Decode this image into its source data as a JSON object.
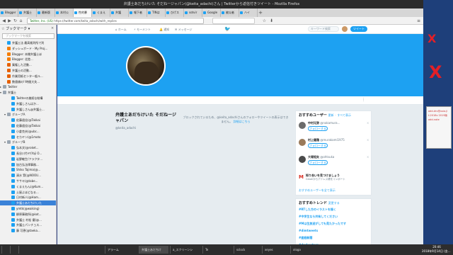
{
  "window": {
    "title": "弁護士あだちけいた そだねージャパン(@keita_adachi)さん | Twitterから返信付きツイート - Mozilla Firefox"
  },
  "tabs": [
    "Blogger",
    "弁護士",
    "最新版",
    "本村公",
    "性的暴",
    "くまえ",
    "弁護",
    "報下者",
    "TINは",
    "ひげス",
    "sotvir",
    "Google",
    "被災者",
    "ハイ"
  ],
  "navbar": {
    "url_secure": "Twitter, Inc. (US)",
    "url": "https://twitter.com/keita_adachi/with_replies"
  },
  "sidebar": {
    "title": "ブックマーク",
    "close": "×",
    "search_placeholder": "ブックマークを検索",
    "items": [
      {
        "label": "弁護士法 最高裁判所で判",
        "icon": "tw",
        "indent": 1
      },
      {
        "label": "ダッシュボード - My Proj...",
        "icon": "bg",
        "indent": 1
      },
      {
        "label": "Blogger: 本棚弁護士ほ",
        "icon": "bg",
        "indent": 1
      },
      {
        "label": "Blogger: 北陸...",
        "icon": "bg",
        "indent": 1
      },
      {
        "label": "棄権した活動...",
        "icon": "fx",
        "indent": 1
      },
      {
        "label": "弁護士の活動...",
        "icon": "fx",
        "indent": 1
      },
      {
        "label": "作業用紙センタ一般ル...",
        "icon": "fx",
        "indent": 1
      },
      {
        "label": "数値順の!!時間大失...",
        "icon": "fx",
        "indent": 1
      },
      {
        "label": "Twitter",
        "icon": "fd",
        "indent": 0,
        "folder": true
      },
      {
        "label": "弁護士",
        "icon": "fd",
        "indent": 0,
        "folder": true,
        "open": true
      },
      {
        "label": "Twitterの美紙な結構",
        "icon": "tw",
        "indent": 2
      },
      {
        "label": "弁護しさんはか...",
        "icon": "tw",
        "indent": 2
      },
      {
        "label": "弁護しさん@弁護士...",
        "icon": "tw",
        "indent": 2
      },
      {
        "label": "グループA",
        "icon": "fd",
        "indent": 1,
        "folder": true,
        "open": true
      },
      {
        "label": "佐藤遥佳(@Takkai",
        "icon": "tw",
        "indent": 2
      },
      {
        "label": "佐藤遥佳(@Takkai",
        "icon": "tw",
        "indent": 2
      },
      {
        "label": "小倉克夫(@ubc...",
        "icon": "tw",
        "indent": 2
      },
      {
        "label": "セカヤン(@1moto",
        "icon": "tw",
        "indent": 2
      },
      {
        "label": "グループB",
        "icon": "fd",
        "indent": 1,
        "folder": true,
        "open": true
      },
      {
        "label": "弘本文(@roket...",
        "icon": "tw",
        "indent": 2
      },
      {
        "label": "長谷川竹ヤ(Yoji O...",
        "icon": "tw",
        "indent": 2
      },
      {
        "label": "岩野敏生/フラクタ...",
        "icon": "tw",
        "indent": 2
      },
      {
        "label": "加古弘法律事務...",
        "icon": "tw",
        "indent": 2
      },
      {
        "label": "Shiko Tajima(@...",
        "icon": "tw",
        "indent": 2
      },
      {
        "label": "清水 賢(@NOOU...",
        "icon": "tw",
        "indent": 2
      },
      {
        "label": "ササキ(@tabe...",
        "icon": "tw",
        "indent": 2
      },
      {
        "label": "くまえもん(@Kum...",
        "icon": "tw",
        "indent": 2
      },
      {
        "label": "土屋よほどなる...",
        "icon": "tw",
        "indent": 2
      },
      {
        "label": "日村新人(@Ham...",
        "icon": "tw",
        "indent": 2
      },
      {
        "label": "弁護士あだちけいた",
        "icon": "tw",
        "indent": 2,
        "selected": true
      },
      {
        "label": "ymtk(@waiking)",
        "icon": "tw",
        "indent": 2
      },
      {
        "label": "柳原事務所(@kot...",
        "icon": "tw",
        "indent": 2
      },
      {
        "label": "弁護士 村松 優(@...",
        "icon": "tw",
        "indent": 2
      },
      {
        "label": "弁護士パンチョス...",
        "icon": "tw",
        "indent": 2
      },
      {
        "label": "藤 可恵(@taeka...",
        "icon": "tw",
        "indent": 2
      }
    ]
  },
  "twitter_nav": {
    "home": "ホーム",
    "moments": "モーメント",
    "notifications": "通知",
    "messages": "メッセージ",
    "search_placeholder": "キーワード検索",
    "tweet_button": "ツイート"
  },
  "profile": {
    "name": "弁護士あだちけいた そだねージャパン",
    "handle": "@keita_adachi",
    "protected_msg": "ブロックされているため、@keita_adachiさんのフォローやツイートの表示はできません。",
    "protected_link": "詳細はこちら",
    "more": "⋮"
  },
  "who_to_follow": {
    "title": "おすすめユーザー",
    "reload": "更新",
    "view_all": "すべて表示",
    "users": [
      {
        "name": "中村元弥",
        "handle": "@nakamura...",
        "follow": "フォローする",
        "avatar_color": "#6b6b6b"
      },
      {
        "name": "村上健雅",
        "handle": "@murakami1975",
        "follow": "フォローする",
        "avatar_color": "#9a7a5a"
      },
      {
        "name": "大塚拓矢",
        "handle": "@ohtsuka",
        "follow": "フォローする",
        "avatar_color": "#4a4a4a"
      }
    ],
    "gmail_title": "知り合いを見つけましょう",
    "gmail_sub": "Gmailからアドレス帳をインポート",
    "all_link": "おすすめユーザーを全て表示"
  },
  "trends": {
    "title": "おすすめトレンド",
    "change": "変更する",
    "items": [
      {
        "h": "#RTした方のイラストを描く",
        "c": "拡散してください"
      },
      {
        "h": "#中学生なら共有してください",
        "c": "6,900件のツイート"
      },
      {
        "h": "#Mは生放送がしても見たかったです",
        "c": "16,500件のツイート"
      },
      {
        "h": "#dimtweets",
        "c": "8,300件のツイート"
      },
      {
        "h": "#産経新聞",
        "c": "4,100件のツイート"
      },
      {
        "h": "#dprkeaters",
        "c": "2,700件のツイート"
      }
    ]
  },
  "right_panel": {
    "x1": "X",
    "x2": "X",
    "note_lines": [
      "add-drv@usia.jl",
      "t:2018v 2019版",
      "add-note"
    ]
  },
  "taskbar": {
    "apps": [
      "",
      "",
      "",
      "アラーム",
      "弁護士あだちけ",
      "a_スクリーンシ",
      "Te",
      "sclock",
      "xeyes",
      "xlogo"
    ],
    "clock_time": "20:46",
    "clock_date": "2018年9月14日 (金曜日)"
  }
}
